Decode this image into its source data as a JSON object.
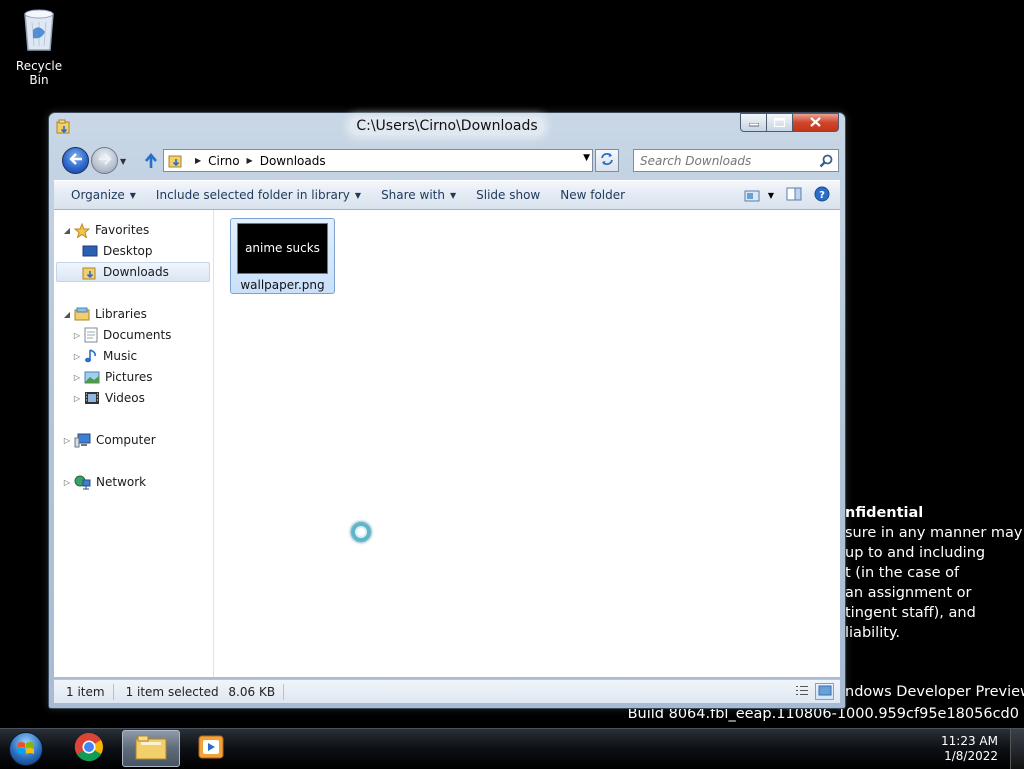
{
  "desktop": {
    "recycle_bin_label": "Recycle Bin",
    "watermark": {
      "title_fragment": "nfidential",
      "lines": [
        "sure in any manner may",
        "up to and including",
        "t (in the case of",
        "an assignment or",
        "tingent staff), and",
        "liability."
      ],
      "product_fragment": "ndows Developer Preview",
      "build": "Build 8064.fbl_eeap.110806-1000.959cf95e18056cd0"
    }
  },
  "window": {
    "title": "C:\\Users\\Cirno\\Downloads",
    "breadcrumb": [
      "Cirno",
      "Downloads"
    ],
    "search_placeholder": "Search Downloads",
    "commands": [
      {
        "label": "Organize",
        "dropdown": true
      },
      {
        "label": "Include selected folder in library",
        "dropdown": true
      },
      {
        "label": "Share with",
        "dropdown": true
      },
      {
        "label": "Slide show",
        "dropdown": false
      },
      {
        "label": "New folder",
        "dropdown": false
      }
    ],
    "nav_tree": {
      "favorites": {
        "label": "Favorites",
        "items": [
          "Desktop",
          "Downloads"
        ],
        "selected": "Downloads"
      },
      "libraries": {
        "label": "Libraries",
        "items": [
          "Documents",
          "Music",
          "Pictures",
          "Videos"
        ]
      },
      "computer": "Computer",
      "network": "Network"
    },
    "files": [
      {
        "name": "wallpaper.png",
        "thumbnail_text": "anime sucks",
        "selected": true
      }
    ],
    "status": {
      "item_count": "1 item",
      "selection": "1 item selected",
      "size": "8.06 KB"
    }
  },
  "taskbar": {
    "apps": [
      "start-orb",
      "chrome",
      "windows-explorer",
      "media-player"
    ],
    "active_app": "windows-explorer",
    "time": "11:23 AM",
    "date": "1/8/2022"
  },
  "colors": {
    "desktop_bg": "#000000",
    "window_frame": "#b3c6da",
    "selection_bg": "#cfe3fa",
    "close_button": "#d1452a"
  }
}
